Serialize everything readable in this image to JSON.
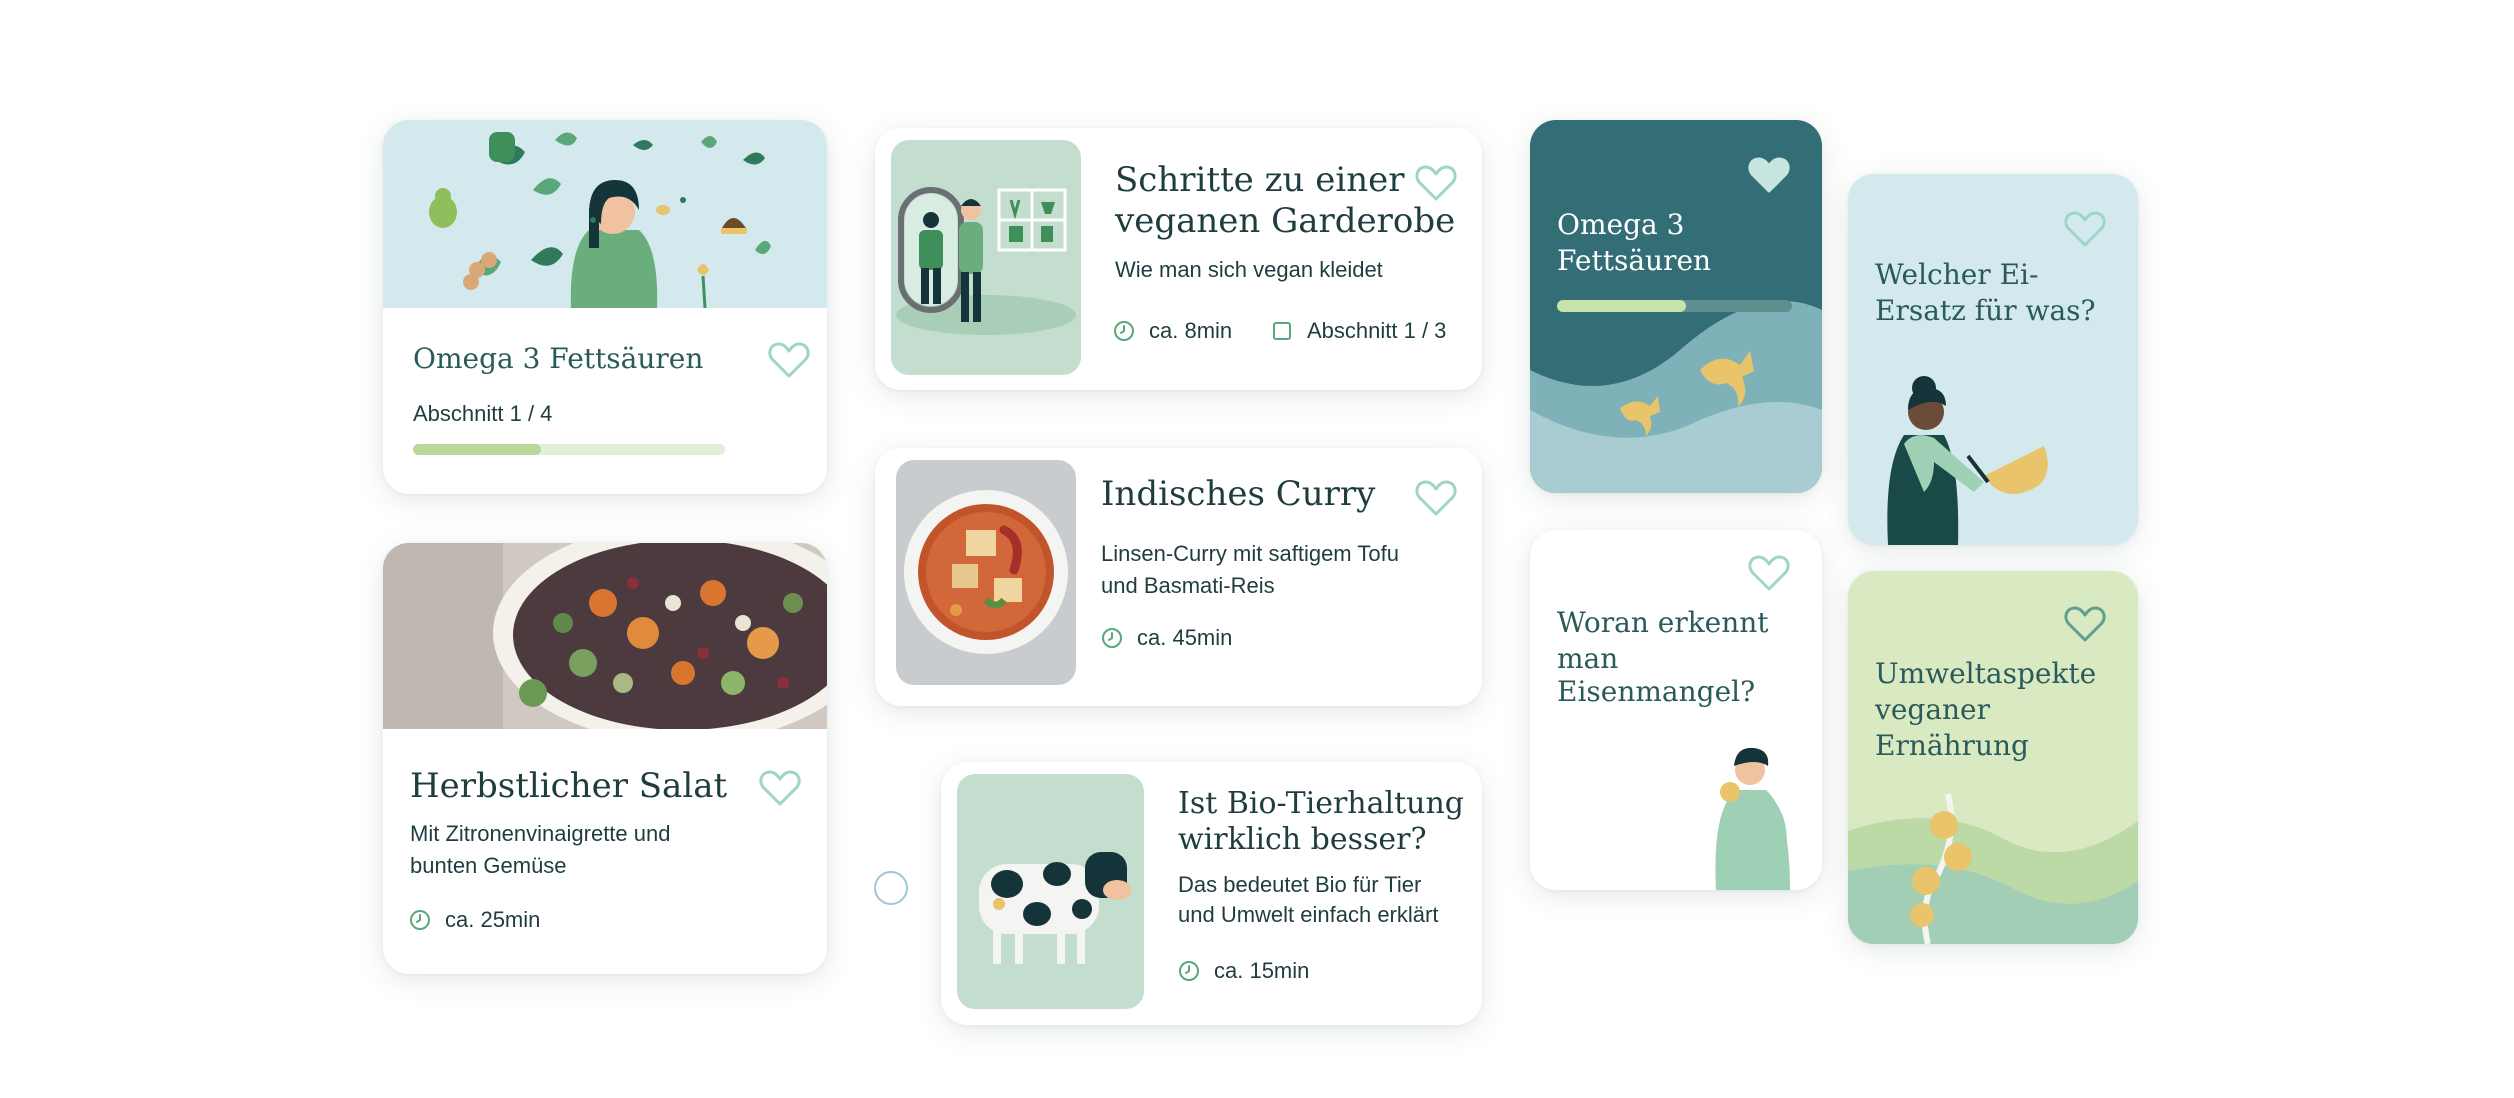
{
  "cards": {
    "omega_article": {
      "title": "Omega 3 Fettsäuren",
      "progress_label": "Abschnitt 1 / 4",
      "progress": 0.41,
      "favorite": false
    },
    "salad": {
      "title": "Herbstlicher Salat",
      "subtitle_line1": "Mit Zitronenvinaigrette und",
      "subtitle_line2": "bunten Gemüse",
      "duration": "ca. 25min",
      "favorite": false
    },
    "wardrobe": {
      "title_line1": "Schritte zu einer",
      "title_line2": "veganen Garderobe",
      "subtitle": "Wie man sich vegan kleidet",
      "duration": "ca. 8min",
      "sections": "Abschnitt 1 / 3",
      "favorite": false
    },
    "curry": {
      "title": "Indisches Curry",
      "subtitle_line1": "Linsen-Curry mit saftigem Tofu",
      "subtitle_line2": "und Basmati-Reis",
      "duration": "ca. 45min",
      "favorite": false
    },
    "bio": {
      "title_line1": "Ist Bio-Tierhaltung",
      "title_line2": "wirklich besser?",
      "subtitle_line1": "Das bedeutet Bio für Tier",
      "subtitle_line2": "und Umwelt einfach erklärt",
      "duration": "ca. 15min",
      "favorite": false
    },
    "omega_tile": {
      "title_line1": "Omega 3",
      "title_line2": "Fettsäuren",
      "progress": 0.55,
      "favorite": true
    },
    "eisenmangel": {
      "title_line1": "Woran erkennt",
      "title_line2": "man Eisenmangel?",
      "favorite": false
    },
    "ei_ersatz": {
      "title_line1": "Welcher Ei-",
      "title_line2": "Ersatz für was?",
      "favorite": false
    },
    "umwelt": {
      "title_line1": "Umweltaspekte",
      "title_line2": "veganer",
      "title_line3": "Ernährung",
      "favorite": false
    }
  },
  "icons": {
    "heart": "heart-icon",
    "heart_filled": "heart-filled-icon",
    "clock": "clock-icon",
    "section": "section-icon",
    "radio": "radio-icon"
  },
  "colors": {
    "text_dark": "#1f3d3f",
    "accent_green": "#5aa77a",
    "heart_outline": "#9fd4c8",
    "teal_tile": "#336e77",
    "light_blue_tile": "#d3e9ed",
    "light_green_tile": "#d9eac3",
    "progress_fill": "#b9d99c",
    "progress_track": "#e3eed9"
  }
}
